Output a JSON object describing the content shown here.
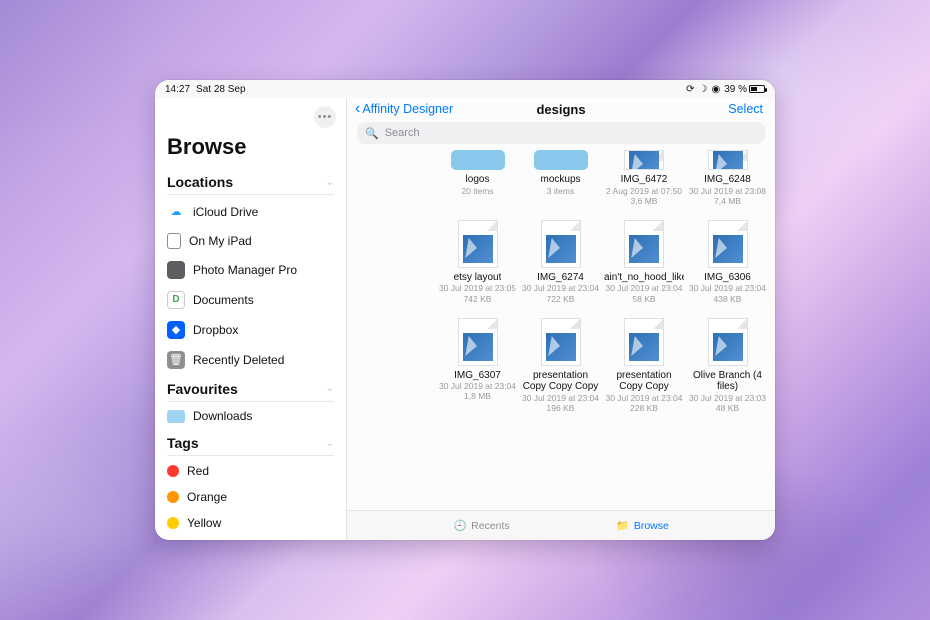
{
  "statusbar": {
    "time": "14:27",
    "date": "Sat 28 Sep",
    "battery_pct": "39 %"
  },
  "sidebar": {
    "title": "Browse",
    "sections": {
      "locations": {
        "label": "Locations",
        "items": [
          {
            "label": "iCloud Drive",
            "icon": "icloud",
            "color": "#1ea0ff"
          },
          {
            "label": "On My iPad",
            "icon": "ipad",
            "color": "#8e8e93"
          },
          {
            "label": "Photo Manager Pro",
            "icon": "app",
            "color": "#5e5e62"
          },
          {
            "label": "Documents",
            "icon": "docapp",
            "color": "#3aa84a"
          },
          {
            "label": "Dropbox",
            "icon": "dropbox",
            "color": "#0061ff"
          },
          {
            "label": "Recently Deleted",
            "icon": "trash",
            "color": "#8e8e93"
          }
        ]
      },
      "favourites": {
        "label": "Favourites",
        "items": [
          {
            "label": "Downloads",
            "icon": "folder",
            "color": "#58b7ea"
          }
        ]
      },
      "tags": {
        "label": "Tags",
        "items": [
          {
            "label": "Red",
            "color": "#ff3b30"
          },
          {
            "label": "Orange",
            "color": "#ff9500"
          },
          {
            "label": "Yellow",
            "color": "#ffcc00"
          }
        ]
      }
    }
  },
  "nav": {
    "back_label": "Affinity Designer",
    "title": "designs",
    "select_label": "Select"
  },
  "search": {
    "placeholder": "Search"
  },
  "grid": {
    "row0": [
      {
        "kind": "folder",
        "name": "logos",
        "meta1": "20 items",
        "meta2": ""
      },
      {
        "kind": "folder",
        "name": "mockups",
        "meta1": "3 items",
        "meta2": ""
      },
      {
        "kind": "file",
        "name": "IMG_6472",
        "meta1": "2 Aug 2019 at 07:50",
        "meta2": "3,6 MB"
      },
      {
        "kind": "file",
        "name": "IMG_6248",
        "meta1": "30 Jul 2019 at 23:08",
        "meta2": "7,4 MB"
      }
    ],
    "row1": [
      {
        "kind": "file",
        "name": "etsy layout",
        "meta1": "30 Jul 2019 at 23:05",
        "meta2": "742 KB"
      },
      {
        "kind": "file",
        "name": "IMG_6274",
        "meta1": "30 Jul 2019 at 23:04",
        "meta2": "722 KB"
      },
      {
        "kind": "file",
        "name": "ain't_no_hood_like_fatherhood",
        "meta1": "30 Jul 2019 at 23:04",
        "meta2": "58 KB"
      },
      {
        "kind": "file",
        "name": "IMG_6306",
        "meta1": "30 Jul 2019 at 23:04",
        "meta2": "438 KB"
      }
    ],
    "row2": [
      {
        "kind": "file",
        "name": "IMG_6307",
        "meta1": "30 Jul 2019 at 23:04",
        "meta2": "1,8 MB"
      },
      {
        "kind": "file",
        "name": "presentation Copy Copy Copy",
        "meta1": "30 Jul 2019 at 23:04",
        "meta2": "196 KB"
      },
      {
        "kind": "file",
        "name": "presentation Copy Copy",
        "meta1": "30 Jul 2019 at 23:04",
        "meta2": "228 KB"
      },
      {
        "kind": "file",
        "name": "Olive Branch (4 files)",
        "meta1": "30 Jul 2019 at 23:03",
        "meta2": "48 KB"
      }
    ]
  },
  "tabs": {
    "recents": "Recents",
    "browse": "Browse"
  }
}
